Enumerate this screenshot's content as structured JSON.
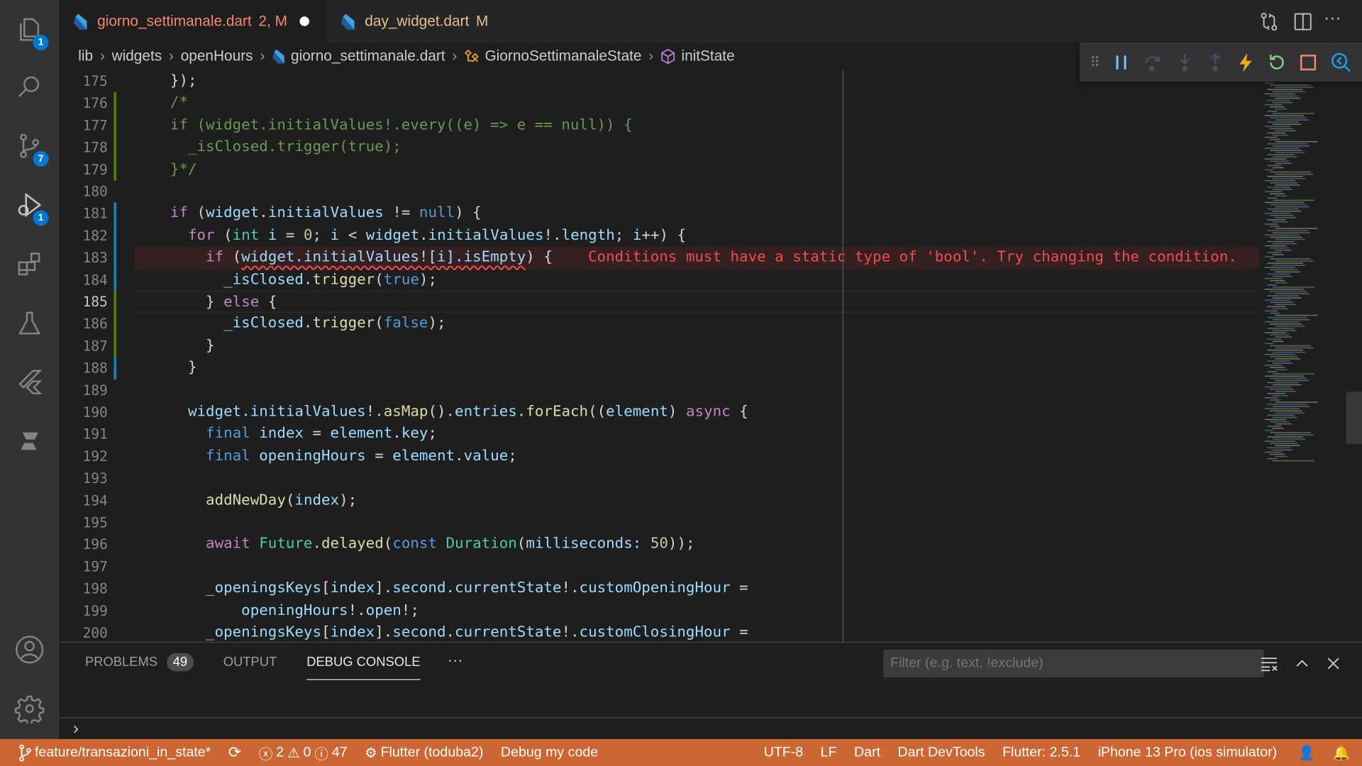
{
  "activity_bar": {
    "explorer_badge": "1",
    "scm_badge": "7",
    "debug_badge": "1"
  },
  "tabs": [
    {
      "label": "giorno_settimanale.dart",
      "status": "2, M",
      "dirty": true,
      "color": "#f48771"
    },
    {
      "label": "day_widget.dart",
      "status": "M",
      "color": "#e2c08d"
    }
  ],
  "breadcrumb": [
    "lib",
    "widgets",
    "openHours",
    "giorno_settimanale.dart",
    "GiornoSettimanaleState",
    "initState"
  ],
  "current_line": 185,
  "code": [
    {
      "n": 175,
      "t": [
        [
          "p",
          "    });"
        ]
      ]
    },
    {
      "n": 176,
      "t": [
        [
          "cm",
          "    /*"
        ]
      ]
    },
    {
      "n": 177,
      "t": [
        [
          "cm",
          "    if (widget.initialValues!.every((e) => e == null)) {"
        ]
      ]
    },
    {
      "n": 178,
      "t": [
        [
          "cm",
          "      _isClosed.trigger(true);"
        ]
      ]
    },
    {
      "n": 179,
      "t": [
        [
          "cm",
          "    }*/"
        ]
      ]
    },
    {
      "n": 180,
      "t": []
    },
    {
      "n": 181,
      "t": [
        [
          "kw",
          "    if"
        ],
        [
          "p",
          " ("
        ],
        [
          "vr",
          "widget"
        ],
        [
          "p",
          "."
        ],
        [
          "vr",
          "initialValues"
        ],
        [
          "p",
          " != "
        ],
        [
          "bl",
          "null"
        ],
        [
          "p",
          ") {"
        ]
      ]
    },
    {
      "n": 182,
      "t": [
        [
          "kw",
          "      for"
        ],
        [
          "p",
          " ("
        ],
        [
          "ty",
          "int"
        ],
        [
          "vr",
          " i"
        ],
        [
          "p",
          " = "
        ],
        [
          "nm",
          "0"
        ],
        [
          "p",
          "; "
        ],
        [
          "vr",
          "i"
        ],
        [
          "p",
          " < "
        ],
        [
          "vr",
          "widget"
        ],
        [
          "p",
          "."
        ],
        [
          "vr",
          "initialValues"
        ],
        [
          "p",
          "!."
        ],
        [
          "vr",
          "length"
        ],
        [
          "p",
          "; "
        ],
        [
          "vr",
          "i"
        ],
        [
          "p",
          "++) {"
        ]
      ]
    },
    {
      "n": 183,
      "error": true,
      "t": [
        [
          "kw",
          "        if"
        ],
        [
          "p",
          " ("
        ],
        [
          "sq",
          "widget.initialValues![i].isEmpty"
        ],
        [
          "p",
          ") {"
        ],
        [
          "er",
          "    Conditions must have a static type of 'bool'. Try changing the condition."
        ]
      ]
    },
    {
      "n": 184,
      "t": [
        [
          "vr",
          "          _isClosed"
        ],
        [
          "p",
          "."
        ],
        [
          "fn",
          "trigger"
        ],
        [
          "p",
          "("
        ],
        [
          "bl",
          "true"
        ],
        [
          "p",
          ");"
        ]
      ]
    },
    {
      "n": 185,
      "t": [
        [
          "p",
          "        } "
        ],
        [
          "kw",
          "else"
        ],
        [
          "p",
          " {"
        ]
      ]
    },
    {
      "n": 186,
      "t": [
        [
          "vr",
          "          _isClosed"
        ],
        [
          "p",
          "."
        ],
        [
          "fn",
          "trigger"
        ],
        [
          "p",
          "("
        ],
        [
          "bl",
          "false"
        ],
        [
          "p",
          ");"
        ]
      ]
    },
    {
      "n": 187,
      "t": [
        [
          "p",
          "        }"
        ]
      ]
    },
    {
      "n": 188,
      "t": [
        [
          "p",
          "      }"
        ]
      ]
    },
    {
      "n": 189,
      "t": []
    },
    {
      "n": 190,
      "t": [
        [
          "vr",
          "      widget"
        ],
        [
          "p",
          "."
        ],
        [
          "vr",
          "initialValues"
        ],
        [
          "p",
          "!."
        ],
        [
          "fn",
          "asMap"
        ],
        [
          "p",
          "()."
        ],
        [
          "vr",
          "entries"
        ],
        [
          "p",
          "."
        ],
        [
          "fn",
          "forEach"
        ],
        [
          "p",
          "(("
        ],
        [
          "vr",
          "element"
        ],
        [
          "p",
          ") "
        ],
        [
          "kw",
          "async"
        ],
        [
          "p",
          " {"
        ]
      ]
    },
    {
      "n": 191,
      "t": [
        [
          "bl",
          "        final"
        ],
        [
          "vr",
          " index"
        ],
        [
          "p",
          " = "
        ],
        [
          "vr",
          "element"
        ],
        [
          "p",
          "."
        ],
        [
          "vr",
          "key"
        ],
        [
          "p",
          ";"
        ]
      ]
    },
    {
      "n": 192,
      "t": [
        [
          "bl",
          "        final"
        ],
        [
          "vr",
          " openingHours"
        ],
        [
          "p",
          " = "
        ],
        [
          "vr",
          "element"
        ],
        [
          "p",
          "."
        ],
        [
          "vr",
          "value"
        ],
        [
          "p",
          ";"
        ]
      ]
    },
    {
      "n": 193,
      "t": []
    },
    {
      "n": 194,
      "t": [
        [
          "fn",
          "        addNewDay"
        ],
        [
          "p",
          "("
        ],
        [
          "vr",
          "index"
        ],
        [
          "p",
          ");"
        ]
      ]
    },
    {
      "n": 195,
      "t": []
    },
    {
      "n": 196,
      "t": [
        [
          "kw",
          "        await"
        ],
        [
          "ty",
          " Future"
        ],
        [
          "p",
          "."
        ],
        [
          "fn",
          "delayed"
        ],
        [
          "p",
          "("
        ],
        [
          "bl",
          "const"
        ],
        [
          "ty",
          " Duration"
        ],
        [
          "p",
          "("
        ],
        [
          "vr",
          "milliseconds"
        ],
        [
          "p",
          ": "
        ],
        [
          "nm",
          "50"
        ],
        [
          "p",
          "));"
        ]
      ]
    },
    {
      "n": 197,
      "t": []
    },
    {
      "n": 198,
      "t": [
        [
          "vr",
          "        _openingsKeys"
        ],
        [
          "p",
          "["
        ],
        [
          "vr",
          "index"
        ],
        [
          "p",
          "]."
        ],
        [
          "vr",
          "second"
        ],
        [
          "p",
          "."
        ],
        [
          "vr",
          "currentState"
        ],
        [
          "p",
          "!."
        ],
        [
          "vr",
          "customOpeningHour"
        ],
        [
          "p",
          " ="
        ]
      ]
    },
    {
      "n": 199,
      "t": [
        [
          "vr",
          "            openingHours"
        ],
        [
          "p",
          "!."
        ],
        [
          "vr",
          "open"
        ],
        [
          "p",
          "!;"
        ]
      ]
    },
    {
      "n": 200,
      "t": [
        [
          "vr",
          "        _openingsKeys"
        ],
        [
          "p",
          "["
        ],
        [
          "vr",
          "index"
        ],
        [
          "p",
          "]."
        ],
        [
          "vr",
          "second"
        ],
        [
          "p",
          "."
        ],
        [
          "vr",
          "currentState"
        ],
        [
          "p",
          "!."
        ],
        [
          "vr",
          "customClosingHour"
        ],
        [
          "p",
          " ="
        ]
      ]
    }
  ],
  "panel": {
    "tabs": [
      "PROBLEMS",
      "OUTPUT",
      "DEBUG CONSOLE"
    ],
    "problems_count": "49",
    "active": "DEBUG CONSOLE",
    "more": "···",
    "filter_placeholder": "Filter (e.g. text, !exclude)",
    "prompt": "›"
  },
  "status": {
    "branch": "feature/transazioni_in_state*",
    "errors": "2",
    "warnings": "0",
    "infos": "47",
    "debug": "Flutter (toduba2)",
    "debug_my_code": "Debug my code",
    "encoding": "UTF-8",
    "eol": "LF",
    "language": "Dart",
    "devtools": "Dart DevTools",
    "flutter": "Flutter: 2.5.1",
    "device": "iPhone 13 Pro (ios simulator)",
    "bg": "#cc6633"
  }
}
